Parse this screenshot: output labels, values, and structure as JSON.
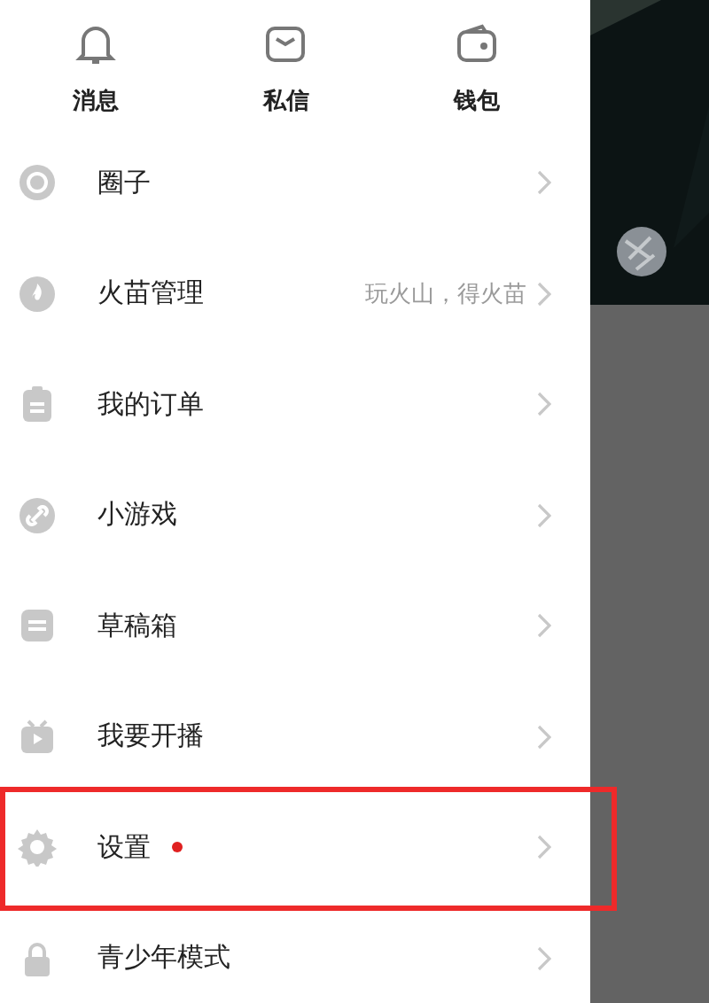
{
  "shortcuts": [
    {
      "label": "消息"
    },
    {
      "label": "私信"
    },
    {
      "label": "钱包"
    }
  ],
  "menu": [
    {
      "label": "圈子",
      "dot": false,
      "highlighted": false
    },
    {
      "label": "火苗管理",
      "hint": "玩火山，得火苗",
      "dot": false,
      "highlighted": false
    },
    {
      "label": "我的订单",
      "dot": false,
      "highlighted": false
    },
    {
      "label": "小游戏",
      "dot": false,
      "highlighted": false
    },
    {
      "label": "草稿箱",
      "dot": false,
      "highlighted": false
    },
    {
      "label": "我要开播",
      "dot": false,
      "highlighted": false
    },
    {
      "label": "设置",
      "dot": true,
      "highlighted": true
    },
    {
      "label": "青少年模式",
      "dot": false,
      "highlighted": false
    }
  ]
}
